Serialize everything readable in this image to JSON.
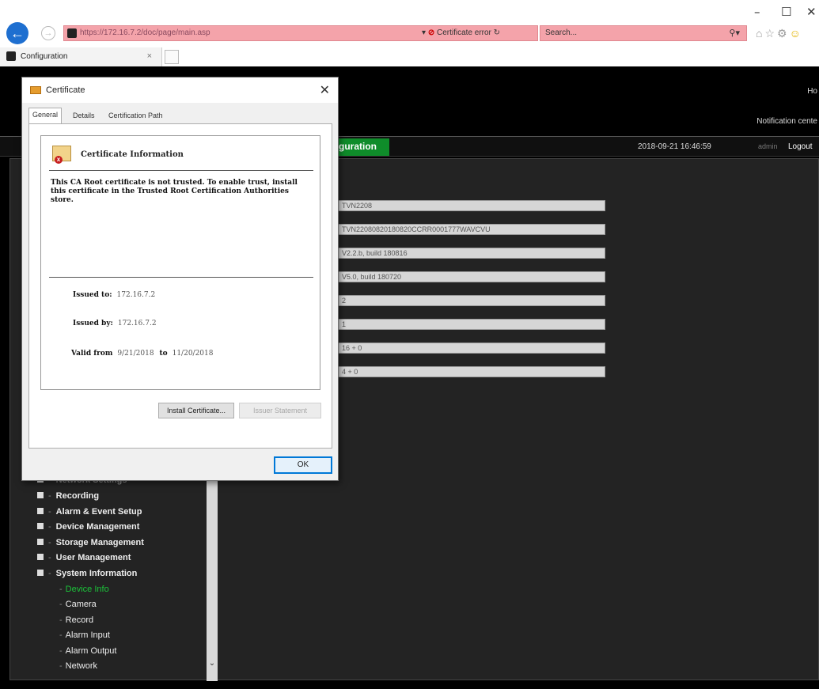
{
  "browser": {
    "address_url": "https://172.16.7.2/doc/page/main.asp",
    "cert_error_label": "Certificate error",
    "search_placeholder": "Search...",
    "tab_title": "Configuration",
    "window_controls": [
      "–",
      "☐",
      "✕"
    ]
  },
  "page": {
    "home_label": "Ho",
    "notification_label": "Notification cente",
    "config_tab_label": "guration",
    "datetime": "2018-09-21 16:46:59",
    "username": "admin",
    "logout_label": "Logout"
  },
  "device_fields": [
    "TVN2208",
    "TVN22080820180820CCRR0001777WAVCVU",
    "V2.2.b, build 180816",
    "V5.0, build 180720",
    "2",
    "1",
    "16 + 0",
    "4 + 0"
  ],
  "sidebar": {
    "partial_item": "Network Settings",
    "items": [
      "Recording",
      "Alarm & Event Setup",
      "Device Management",
      "Storage Management",
      "User Management",
      "System Information"
    ],
    "children": [
      "Device Info",
      "Camera",
      "Record",
      "Alarm Input",
      "Alarm Output",
      "Network"
    ],
    "active_child_index": 0
  },
  "dialog": {
    "title": "Certificate",
    "tabs": [
      "General",
      "Details",
      "Certification Path"
    ],
    "heading": "Certificate Information",
    "message": "This CA Root certificate is not trusted. To enable trust, install this certificate in the Trusted Root Certification Authorities store.",
    "issued_to_label": "Issued to:",
    "issued_to": "172.16.7.2",
    "issued_by_label": "Issued by:",
    "issued_by": "172.16.7.2",
    "valid_from_label": "Valid from",
    "valid_from": "9/21/2018",
    "valid_to_label": "to",
    "valid_to": "11/20/2018",
    "install_button": "Install Certificate...",
    "issuer_button": "Issuer Statement",
    "ok_button": "OK"
  },
  "colors": {
    "accent_green": "#0f8c2a",
    "active_item_green": "#1bc43a",
    "cert_error_bg": "#f4a3aa",
    "ok_border_blue": "#0078d7"
  }
}
